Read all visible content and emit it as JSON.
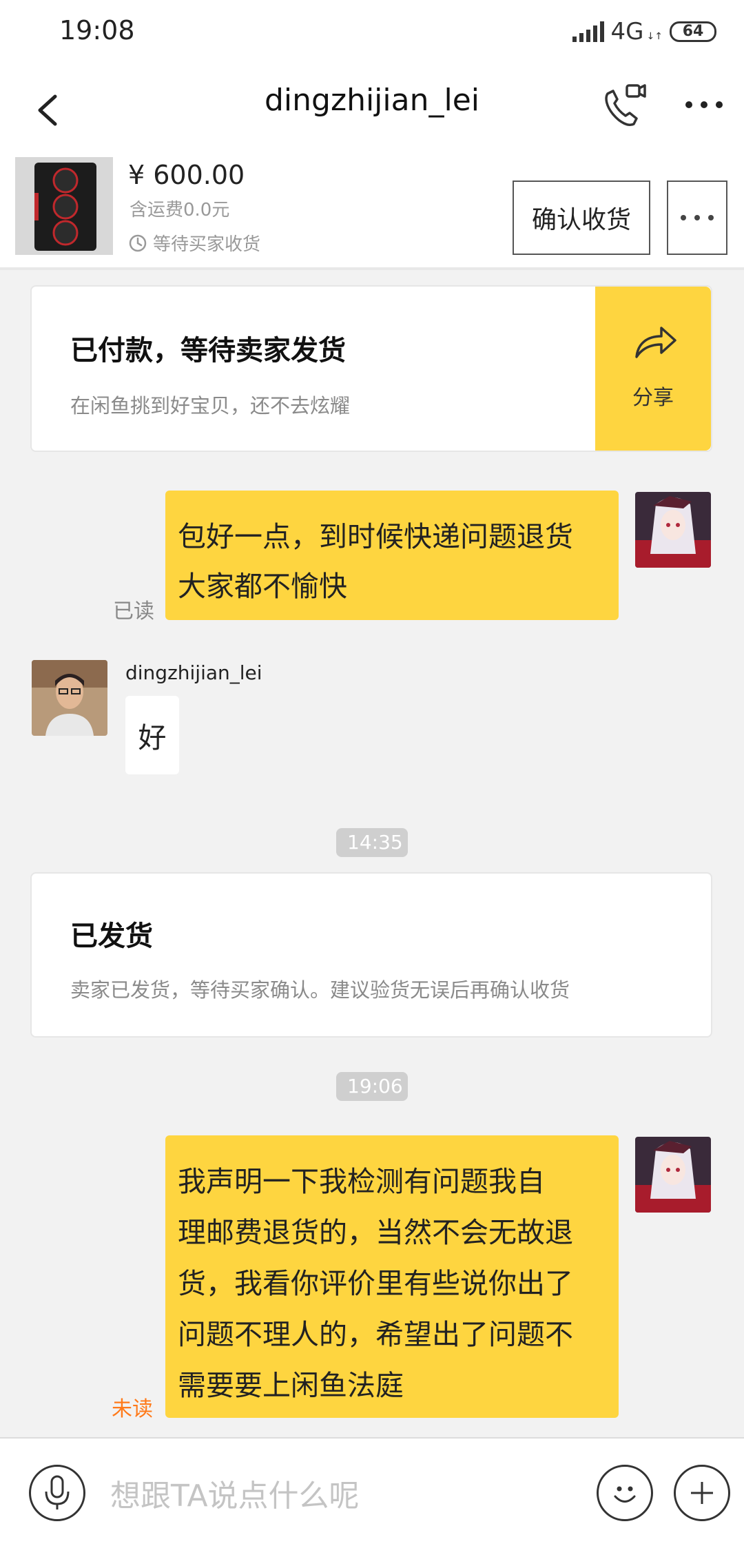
{
  "status_bar": {
    "time": "19:08",
    "network": "4G",
    "battery": "64"
  },
  "nav": {
    "title": "dingzhijian_lei"
  },
  "product": {
    "price": "¥ 600.00",
    "shipping": "含运费0.0元",
    "status": "等待买家收货",
    "confirm_label": "确认收货"
  },
  "cards": {
    "paid": {
      "title": "已付款，等待卖家发货",
      "subtitle": "在闲鱼挑到好宝贝，还不去炫耀",
      "share_label": "分享"
    },
    "shipped": {
      "title": "已发货",
      "subtitle": "卖家已发货，等待买家确认。建议验货无误后再确认收货"
    }
  },
  "messages": {
    "msg1": {
      "lines": [
        "包好一点，到时候快递问题退货",
        "大家都不愉快"
      ],
      "status": "已读"
    },
    "msg2": {
      "sender": "dingzhijian_lei",
      "text": "好"
    },
    "time1": "14:35",
    "time2": "19:06",
    "msg3": {
      "lines": [
        "我声明一下我检测有问题我自",
        "理邮费退货的，当然不会无故退",
        "货，我看你评价里有些说你出了",
        "问题不理人的，希望出了问题不",
        "需要要上闲鱼法庭"
      ],
      "status": "未读"
    }
  },
  "input": {
    "placeholder": "想跟TA说点什么呢"
  },
  "colors": {
    "accent": "#fed540",
    "unread": "#ff7a1a",
    "read": "#888888"
  },
  "icons": [
    "back-icon",
    "video-call-icon",
    "more-icon",
    "clock-icon",
    "share-icon",
    "microphone-icon",
    "emoji-icon",
    "plus-icon"
  ]
}
